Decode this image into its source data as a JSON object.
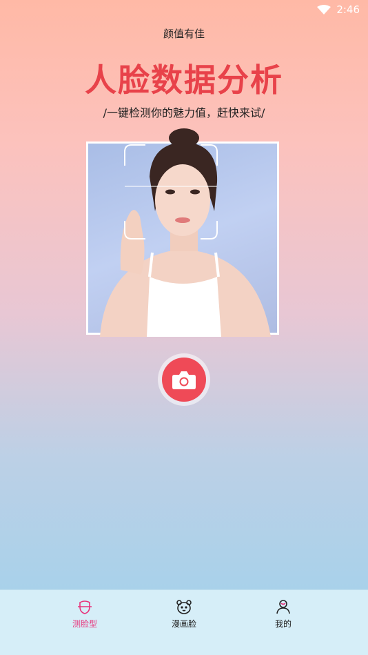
{
  "status": {
    "time": "2:46"
  },
  "app_title": "颜值有佳",
  "headline": "人脸数据分析",
  "subtitle": "/一键检测你的魅力值，赶快来试/",
  "nav": [
    {
      "label": "测脸型",
      "icon": "face-scan-icon",
      "active": true
    },
    {
      "label": "漫画脸",
      "icon": "bear-face-icon",
      "active": false
    },
    {
      "label": "我的",
      "icon": "user-icon",
      "active": false
    }
  ],
  "colors": {
    "accent": "#e8424a",
    "nav_active": "#e8327a",
    "camera": "#ef4a57"
  }
}
